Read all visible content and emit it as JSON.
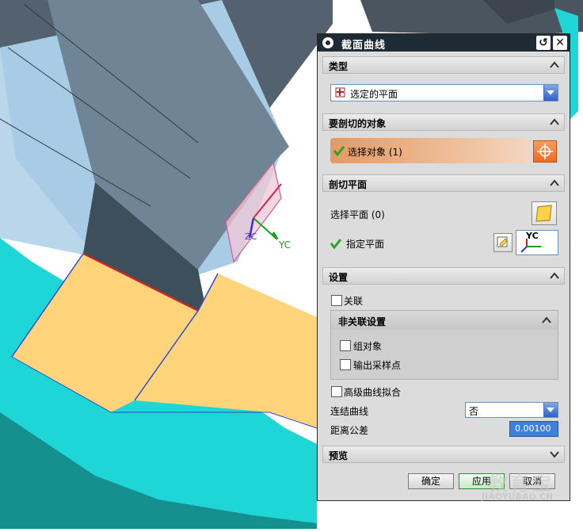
{
  "viewport": {
    "axis_labels": {
      "zc": "ZC",
      "yc": "YC"
    }
  },
  "dialog": {
    "title": "截面曲线",
    "title_icons": {
      "left": "gear-icon",
      "reset": "reset-icon",
      "close": "close-icon"
    },
    "sections": {
      "type": {
        "header": "类型",
        "select_value": "选定的平面",
        "select_icon": "plane-type-icon"
      },
      "objects": {
        "header": "要剖切的对象",
        "select_label": "选择对象 (1)",
        "target_icon": "crosshair-icon"
      },
      "plane": {
        "header": "剖切平面",
        "select_plane_label": "选择平面 (0)",
        "specify_plane_label": "指定平面",
        "plane_icon": "plane-icon",
        "dialog_icon": "plane-dialog-icon",
        "axis_button_text": "YC"
      },
      "settings": {
        "header": "设置",
        "associative_label": "关联",
        "nonassoc_header": "非关联设置",
        "group_objects_label": "组对象",
        "output_sample_label": "输出采样点",
        "advanced_fit_label": "高级曲线拟合",
        "join_curves_label": "连结曲线",
        "join_curves_value": "否",
        "distance_tol_label": "距离公差",
        "distance_tol_value": "0.00100"
      },
      "preview": {
        "header": "预览"
      }
    },
    "buttons": {
      "ok": "确定",
      "apply": "应用",
      "cancel": "取消"
    },
    "colors": {
      "titlebar": "#1e2a34",
      "selection_highlight": "#e7a87a",
      "check": "#2aa52a"
    }
  },
  "watermark": {
    "line1": "教育宝",
    "line2": "JIAOYUBAO.CN"
  }
}
